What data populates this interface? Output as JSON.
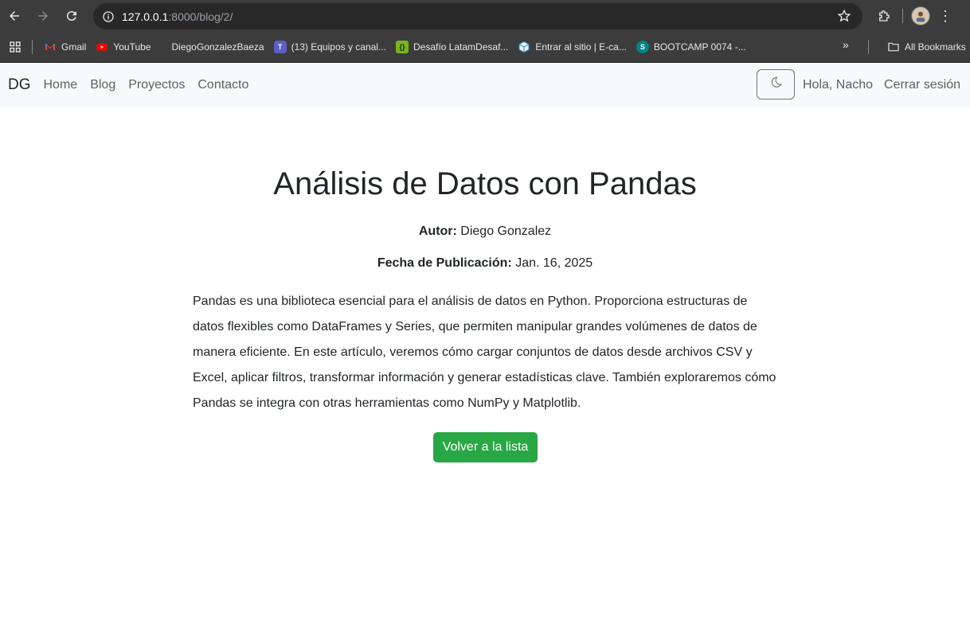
{
  "browser": {
    "url_host": "127.0.0.1",
    "url_path": ":8000/blog/2/",
    "bookmarks": [
      {
        "label": "Gmail",
        "icon": "gmail-icon"
      },
      {
        "label": "YouTube",
        "icon": "youtube-icon"
      },
      {
        "label": "DiegoGonzalezBaeza",
        "icon": "blank-icon"
      },
      {
        "label": "(13) Equipos y canal...",
        "icon": "teams-icon"
      },
      {
        "label": "Desafío LatamDesaf...",
        "icon": "desafio-icon"
      },
      {
        "label": "Entrar al sitio | E-ca...",
        "icon": "box-icon"
      },
      {
        "label": "BOOTCAMP 0074 -...",
        "icon": "sharepoint-icon"
      }
    ],
    "all_bookmarks_label": "All Bookmarks"
  },
  "nav": {
    "brand": "DG",
    "links": [
      "Home",
      "Blog",
      "Proyectos",
      "Contacto"
    ],
    "greeting": "Hola, Nacho",
    "logout": "Cerrar sesión"
  },
  "post": {
    "title": "Análisis de Datos con Pandas",
    "author_label": "Autor:",
    "author": "Diego Gonzalez",
    "date_label": "Fecha de Publicación:",
    "date": "Jan. 16, 2025",
    "body": "Pandas es una biblioteca esencial para el análisis de datos en Python. Proporciona estructuras de datos flexibles como DataFrames y Series, que permiten manipular grandes volúmenes de datos de manera eficiente. En este artículo, veremos cómo cargar conjuntos de datos desde archivos CSV y Excel, aplicar filtros, transformar información y generar estadísticas clave. También exploraremos cómo Pandas se integra con otras herramientas como NumPy y Matplotlib.",
    "back_button": "Volver a la lista"
  },
  "colors": {
    "chrome_bg": "#3c3c3c",
    "omnibox_bg": "#282828",
    "navbar_bg": "#f8f9fa",
    "button_green": "#28a745"
  }
}
